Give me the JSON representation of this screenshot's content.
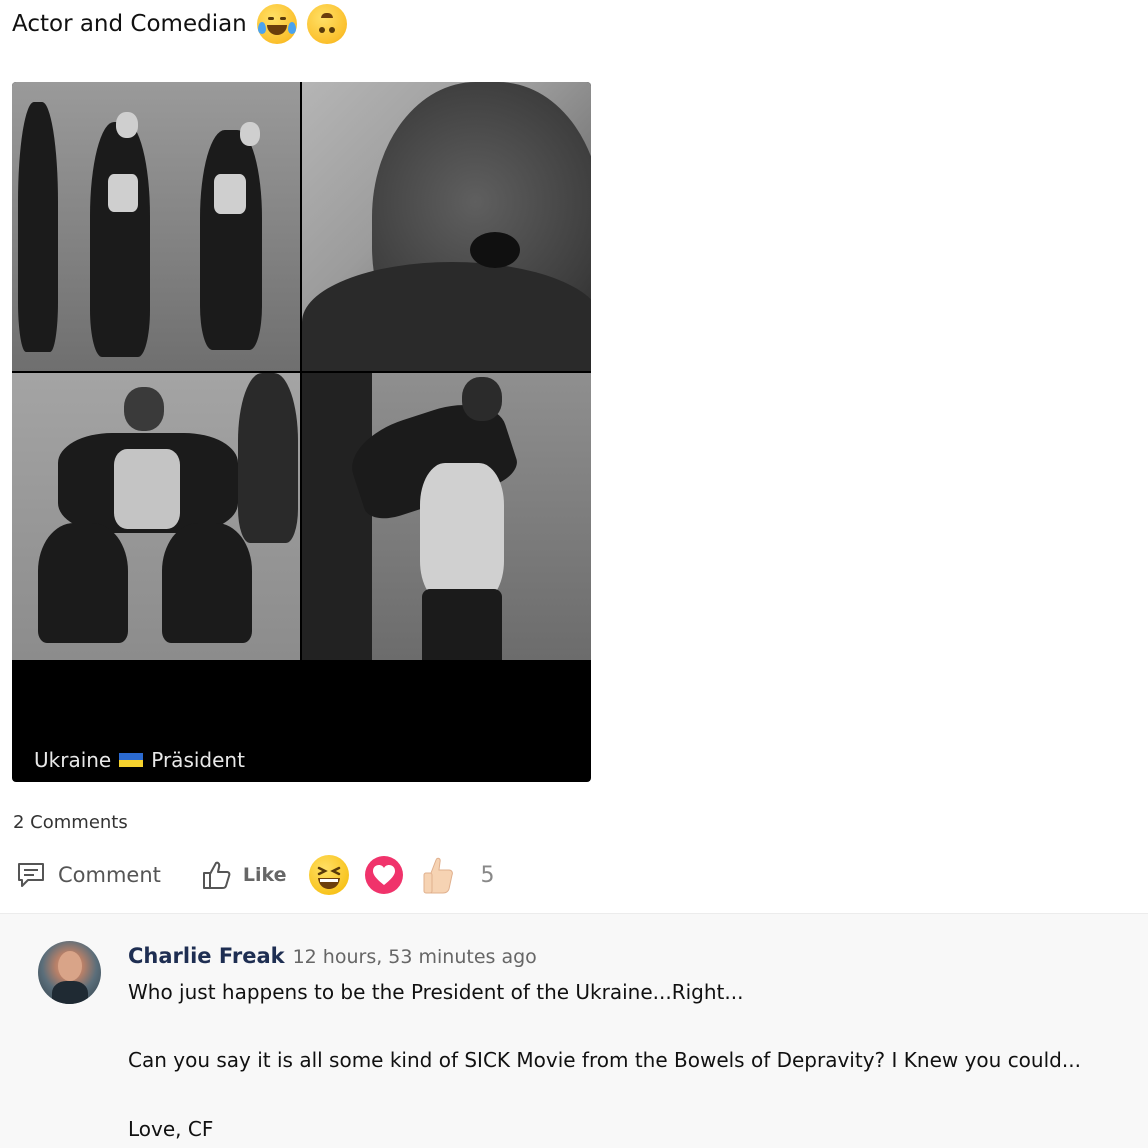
{
  "post": {
    "title": "Actor and Comedian",
    "title_emojis": [
      "laughing-tears-icon",
      "upside-down-face-icon"
    ],
    "image_caption_left": "Ukraine",
    "image_caption_right": "Präsident"
  },
  "stats": {
    "comments_label": "2 Comments",
    "reaction_count": "5"
  },
  "actions": {
    "comment_label": "Comment",
    "like_label": "Like",
    "reactions": [
      "grinning-squint-icon",
      "heart-icon",
      "thumbs-up-icon"
    ]
  },
  "comment": {
    "author": "Charlie Freak",
    "time": "12 hours, 53 minutes ago",
    "lines": [
      "Who just happens to be the President of the Ukraine...Right...",
      "Can you say it is all some kind of SICK Movie from the Bowels of Depravity? I Knew you could...",
      "Love, CF"
    ]
  },
  "colors": {
    "author": "#1e2e52",
    "heart": "#f0336b",
    "comment_bg": "#f8f8f8"
  }
}
